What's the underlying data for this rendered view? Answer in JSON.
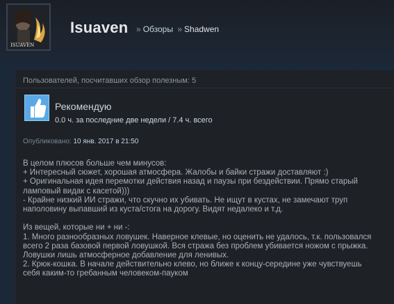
{
  "header": {
    "persona_name": "Isuaven",
    "avatar_label": "ISUAVEN",
    "breadcrumb": {
      "separator": "»",
      "reviews": "Обзоры",
      "game": "Shadwen"
    }
  },
  "helpful": "Пользователей, посчитавших обзор полезным: 5",
  "review_header": {
    "verdict": "Рекомендую",
    "hours": "0.0 ч. за последние две недели / 7.4 ч. всего",
    "thumb_icon": "thumbs-up-icon"
  },
  "posted": {
    "label": "Опубликовано:",
    "date": "10 янв. 2017 в 21:50"
  },
  "review_lines": [
    "В целом плюсов больше чем минусов:",
    "+ Интересный сюжет, хорошая атмосфера. Жалобы и байки стражи доставляют :)",
    "+ Оригинальная идея перемотки действия назад и паузы при бездействии. Прямо старый",
    "ламповый видак с касетой)))",
    "- Крайне низкий ИИ стражи, что скучно их убивать. Не ищут в кустах, не замечают труп",
    "наполовину выпавший из куста/стога на дорогу. Видят недалеко и т.д.",
    "",
    "Из вещей, которые ни + ни -:",
    "1. Много разнообразных ловушек. Наверное клевые, но оценить не удалось, т.к. пользовался",
    "всего 2 раза базовой первой ловушкой. Вся стража без проблем убивается ножом с прыжка.",
    "Ловушки лишь атмосферное добавление для ленивых.",
    "2. Крюк-кошка. В начале действительно клево, но ближе к концу-середине уже чувствуешь",
    "себя каким-то гребанным человеком-пауком"
  ],
  "colors": {
    "background": "#1b2838",
    "panel": "#1e2126",
    "thumb": "#5aa9e6"
  }
}
